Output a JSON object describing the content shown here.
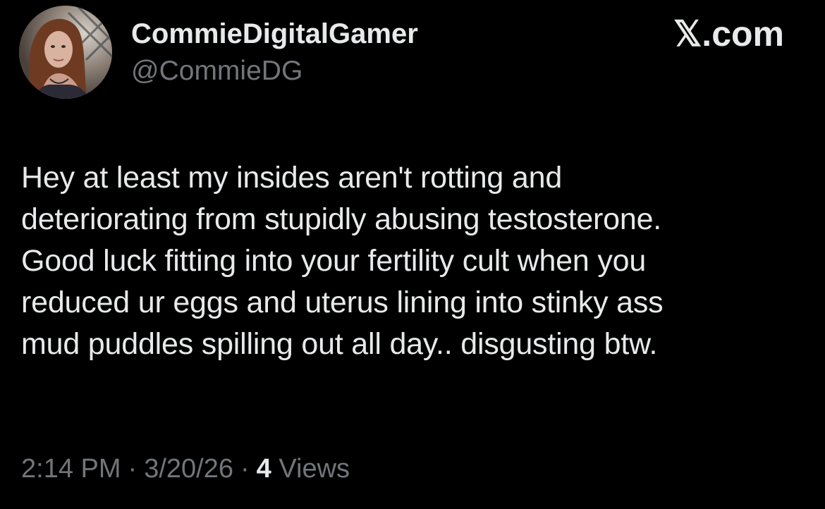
{
  "user": {
    "display_name": "CommieDigitalGamer",
    "handle": "@CommieDG",
    "avatar_icon": "profile-photo"
  },
  "brand": {
    "label": "𝕏.com"
  },
  "tweet": {
    "lines": [
      "Hey at least my insides aren't rotting and",
      "deteriorating from stupidly abusing testosterone.",
      "Good luck fitting into your fertility cult when you",
      "reduced ur eggs and uterus lining into stinky ass",
      "mud puddles spilling out all day.. disgusting btw."
    ]
  },
  "meta": {
    "time": "2:14 PM",
    "separator": "·",
    "date": "3/20/26",
    "views_count": "4",
    "views_label": "Views"
  },
  "colors": {
    "background": "#000000",
    "primary_text": "#e7e9ea",
    "secondary_text": "#71767b"
  }
}
